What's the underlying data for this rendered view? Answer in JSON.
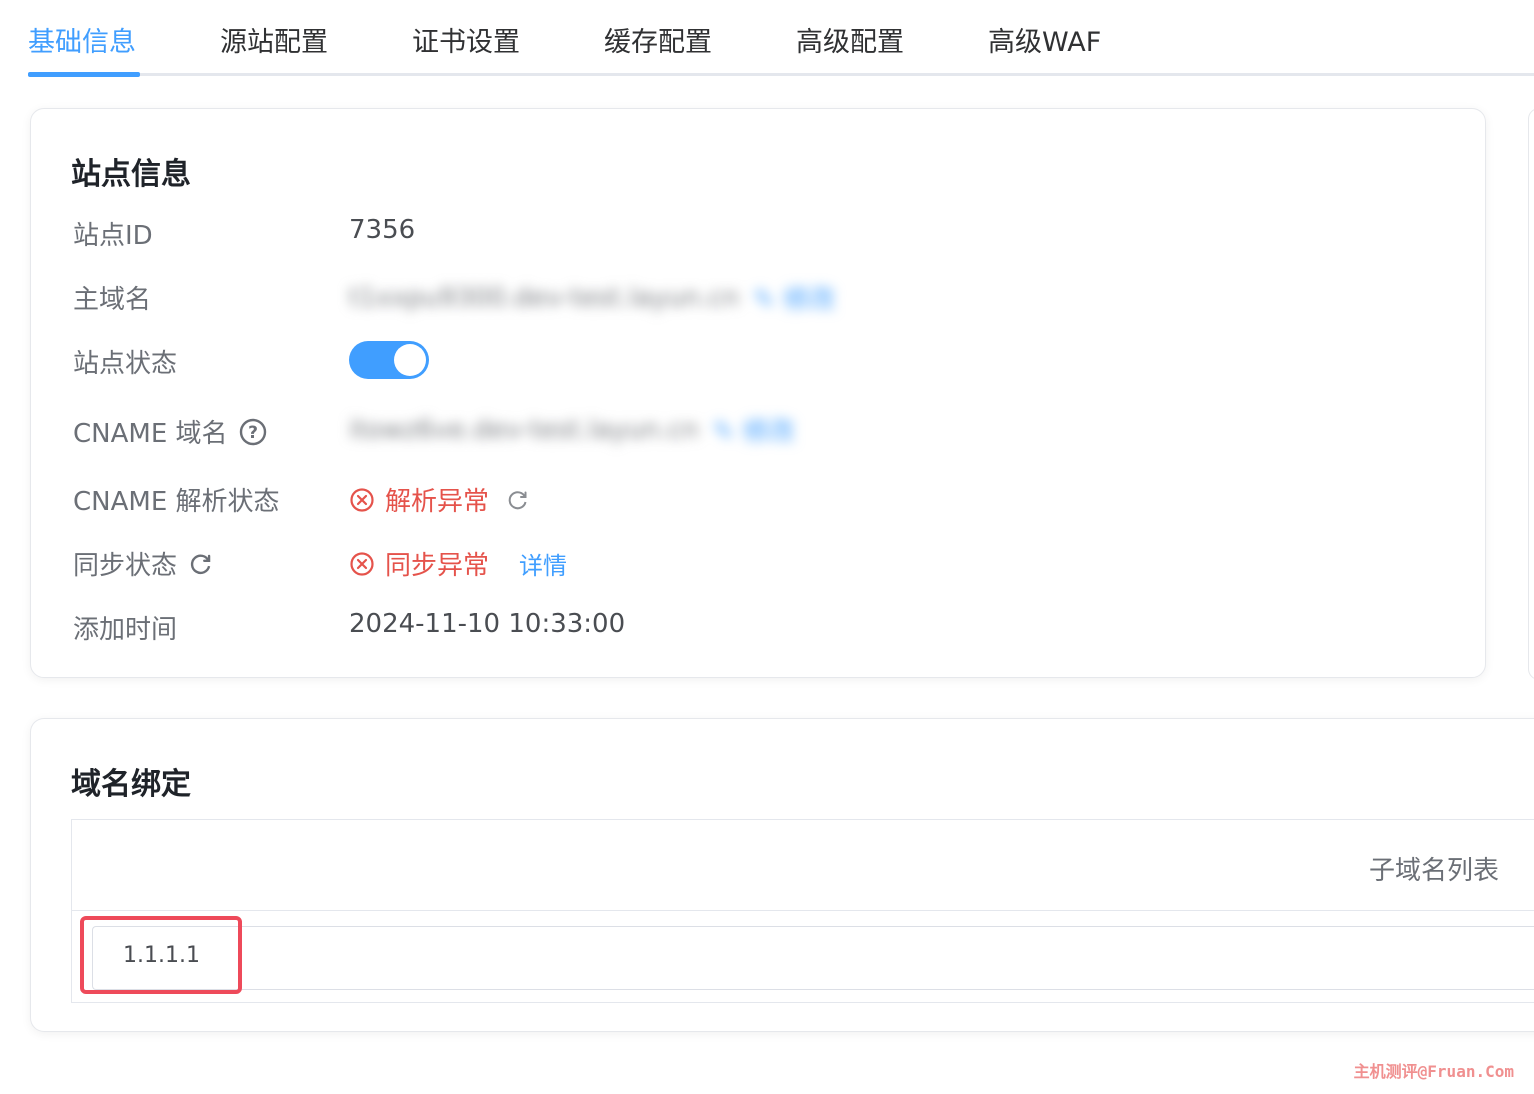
{
  "tabs": [
    {
      "label": "基础信息",
      "active": true
    },
    {
      "label": "源站配置",
      "active": false
    },
    {
      "label": "证书设置",
      "active": false
    },
    {
      "label": "缓存配置",
      "active": false
    },
    {
      "label": "高级配置",
      "active": false
    },
    {
      "label": "高级WAF",
      "active": false
    }
  ],
  "site_info": {
    "title": "站点信息",
    "rows": {
      "site_id": {
        "label": "站点ID",
        "value": "7356"
      },
      "main_domain": {
        "label": "主域名",
        "value": "t1xxpu9300.dev-test.layun.cn",
        "edit": "修改"
      },
      "site_status": {
        "label": "站点状态",
        "enabled": true
      },
      "cname_domain": {
        "label": "CNAME 域名",
        "value": "itowz6ve.dev-test.layun.cn",
        "edit": "修改"
      },
      "cname_resolve": {
        "label": "CNAME 解析状态",
        "value": "解析异常"
      },
      "sync_status": {
        "label": "同步状态",
        "value": "同步异常",
        "detail": "详情"
      },
      "added_time": {
        "label": "添加时间",
        "value": "2024-11-10 10:33:00"
      }
    }
  },
  "domain_binding": {
    "title": "域名绑定",
    "column_header": "子域名列表",
    "input_value": "1.1.1.1"
  },
  "watermark": "主机测评@Fruan.Com",
  "colors": {
    "primary": "#409eff",
    "error": "#e5534b",
    "highlight": "#ee4a5a"
  }
}
